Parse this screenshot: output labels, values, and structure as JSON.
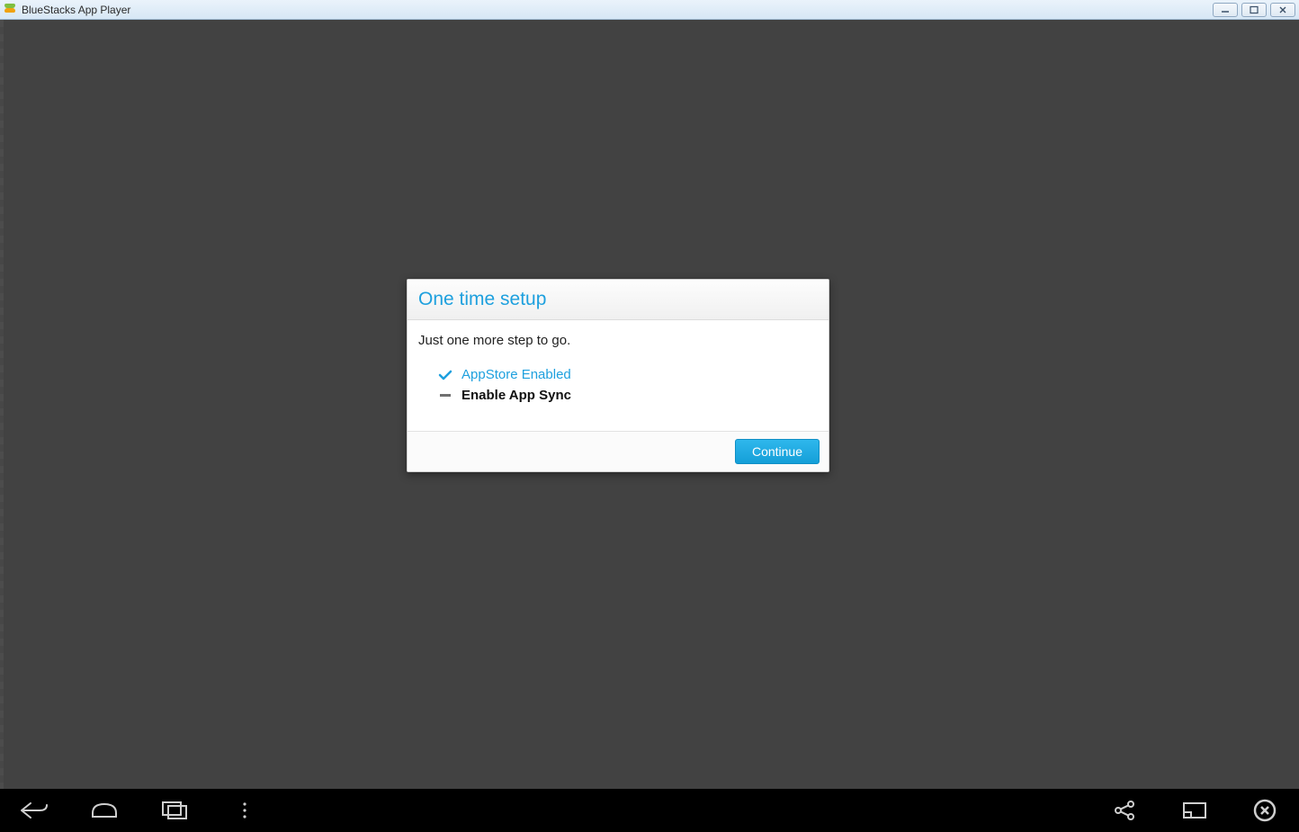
{
  "window": {
    "title": "BlueStacks App Player"
  },
  "dialog": {
    "title": "One time setup",
    "subtitle": "Just one more step to go.",
    "items": [
      {
        "label": "AppStore Enabled",
        "state": "done"
      },
      {
        "label": "Enable App Sync",
        "state": "pending"
      }
    ],
    "continue_label": "Continue"
  }
}
